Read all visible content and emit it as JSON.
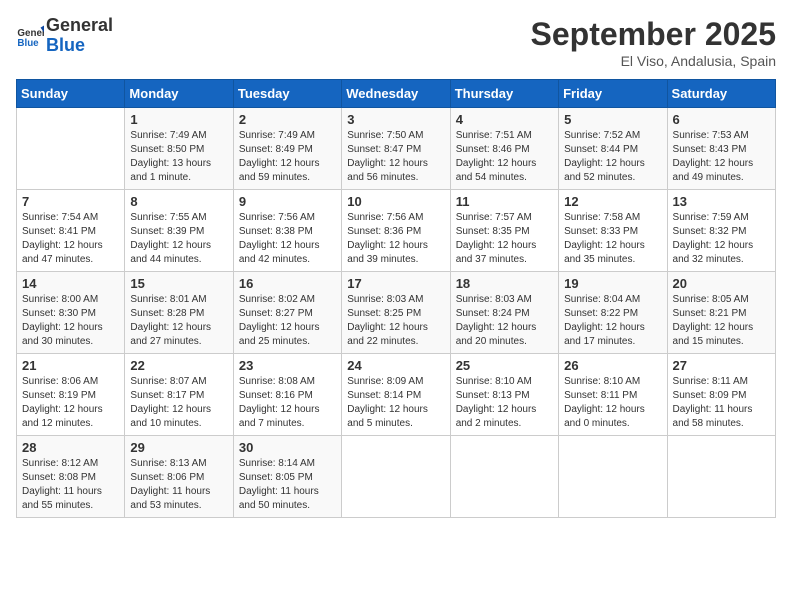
{
  "header": {
    "logo_line1": "General",
    "logo_line2": "Blue",
    "month": "September 2025",
    "location": "El Viso, Andalusia, Spain"
  },
  "days_of_week": [
    "Sunday",
    "Monday",
    "Tuesday",
    "Wednesday",
    "Thursday",
    "Friday",
    "Saturday"
  ],
  "weeks": [
    [
      {
        "day": "",
        "info": ""
      },
      {
        "day": "1",
        "info": "Sunrise: 7:49 AM\nSunset: 8:50 PM\nDaylight: 13 hours\nand 1 minute."
      },
      {
        "day": "2",
        "info": "Sunrise: 7:49 AM\nSunset: 8:49 PM\nDaylight: 12 hours\nand 59 minutes."
      },
      {
        "day": "3",
        "info": "Sunrise: 7:50 AM\nSunset: 8:47 PM\nDaylight: 12 hours\nand 56 minutes."
      },
      {
        "day": "4",
        "info": "Sunrise: 7:51 AM\nSunset: 8:46 PM\nDaylight: 12 hours\nand 54 minutes."
      },
      {
        "day": "5",
        "info": "Sunrise: 7:52 AM\nSunset: 8:44 PM\nDaylight: 12 hours\nand 52 minutes."
      },
      {
        "day": "6",
        "info": "Sunrise: 7:53 AM\nSunset: 8:43 PM\nDaylight: 12 hours\nand 49 minutes."
      }
    ],
    [
      {
        "day": "7",
        "info": "Sunrise: 7:54 AM\nSunset: 8:41 PM\nDaylight: 12 hours\nand 47 minutes."
      },
      {
        "day": "8",
        "info": "Sunrise: 7:55 AM\nSunset: 8:39 PM\nDaylight: 12 hours\nand 44 minutes."
      },
      {
        "day": "9",
        "info": "Sunrise: 7:56 AM\nSunset: 8:38 PM\nDaylight: 12 hours\nand 42 minutes."
      },
      {
        "day": "10",
        "info": "Sunrise: 7:56 AM\nSunset: 8:36 PM\nDaylight: 12 hours\nand 39 minutes."
      },
      {
        "day": "11",
        "info": "Sunrise: 7:57 AM\nSunset: 8:35 PM\nDaylight: 12 hours\nand 37 minutes."
      },
      {
        "day": "12",
        "info": "Sunrise: 7:58 AM\nSunset: 8:33 PM\nDaylight: 12 hours\nand 35 minutes."
      },
      {
        "day": "13",
        "info": "Sunrise: 7:59 AM\nSunset: 8:32 PM\nDaylight: 12 hours\nand 32 minutes."
      }
    ],
    [
      {
        "day": "14",
        "info": "Sunrise: 8:00 AM\nSunset: 8:30 PM\nDaylight: 12 hours\nand 30 minutes."
      },
      {
        "day": "15",
        "info": "Sunrise: 8:01 AM\nSunset: 8:28 PM\nDaylight: 12 hours\nand 27 minutes."
      },
      {
        "day": "16",
        "info": "Sunrise: 8:02 AM\nSunset: 8:27 PM\nDaylight: 12 hours\nand 25 minutes."
      },
      {
        "day": "17",
        "info": "Sunrise: 8:03 AM\nSunset: 8:25 PM\nDaylight: 12 hours\nand 22 minutes."
      },
      {
        "day": "18",
        "info": "Sunrise: 8:03 AM\nSunset: 8:24 PM\nDaylight: 12 hours\nand 20 minutes."
      },
      {
        "day": "19",
        "info": "Sunrise: 8:04 AM\nSunset: 8:22 PM\nDaylight: 12 hours\nand 17 minutes."
      },
      {
        "day": "20",
        "info": "Sunrise: 8:05 AM\nSunset: 8:21 PM\nDaylight: 12 hours\nand 15 minutes."
      }
    ],
    [
      {
        "day": "21",
        "info": "Sunrise: 8:06 AM\nSunset: 8:19 PM\nDaylight: 12 hours\nand 12 minutes."
      },
      {
        "day": "22",
        "info": "Sunrise: 8:07 AM\nSunset: 8:17 PM\nDaylight: 12 hours\nand 10 minutes."
      },
      {
        "day": "23",
        "info": "Sunrise: 8:08 AM\nSunset: 8:16 PM\nDaylight: 12 hours\nand 7 minutes."
      },
      {
        "day": "24",
        "info": "Sunrise: 8:09 AM\nSunset: 8:14 PM\nDaylight: 12 hours\nand 5 minutes."
      },
      {
        "day": "25",
        "info": "Sunrise: 8:10 AM\nSunset: 8:13 PM\nDaylight: 12 hours\nand 2 minutes."
      },
      {
        "day": "26",
        "info": "Sunrise: 8:10 AM\nSunset: 8:11 PM\nDaylight: 12 hours\nand 0 minutes."
      },
      {
        "day": "27",
        "info": "Sunrise: 8:11 AM\nSunset: 8:09 PM\nDaylight: 11 hours\nand 58 minutes."
      }
    ],
    [
      {
        "day": "28",
        "info": "Sunrise: 8:12 AM\nSunset: 8:08 PM\nDaylight: 11 hours\nand 55 minutes."
      },
      {
        "day": "29",
        "info": "Sunrise: 8:13 AM\nSunset: 8:06 PM\nDaylight: 11 hours\nand 53 minutes."
      },
      {
        "day": "30",
        "info": "Sunrise: 8:14 AM\nSunset: 8:05 PM\nDaylight: 11 hours\nand 50 minutes."
      },
      {
        "day": "",
        "info": ""
      },
      {
        "day": "",
        "info": ""
      },
      {
        "day": "",
        "info": ""
      },
      {
        "day": "",
        "info": ""
      }
    ]
  ]
}
